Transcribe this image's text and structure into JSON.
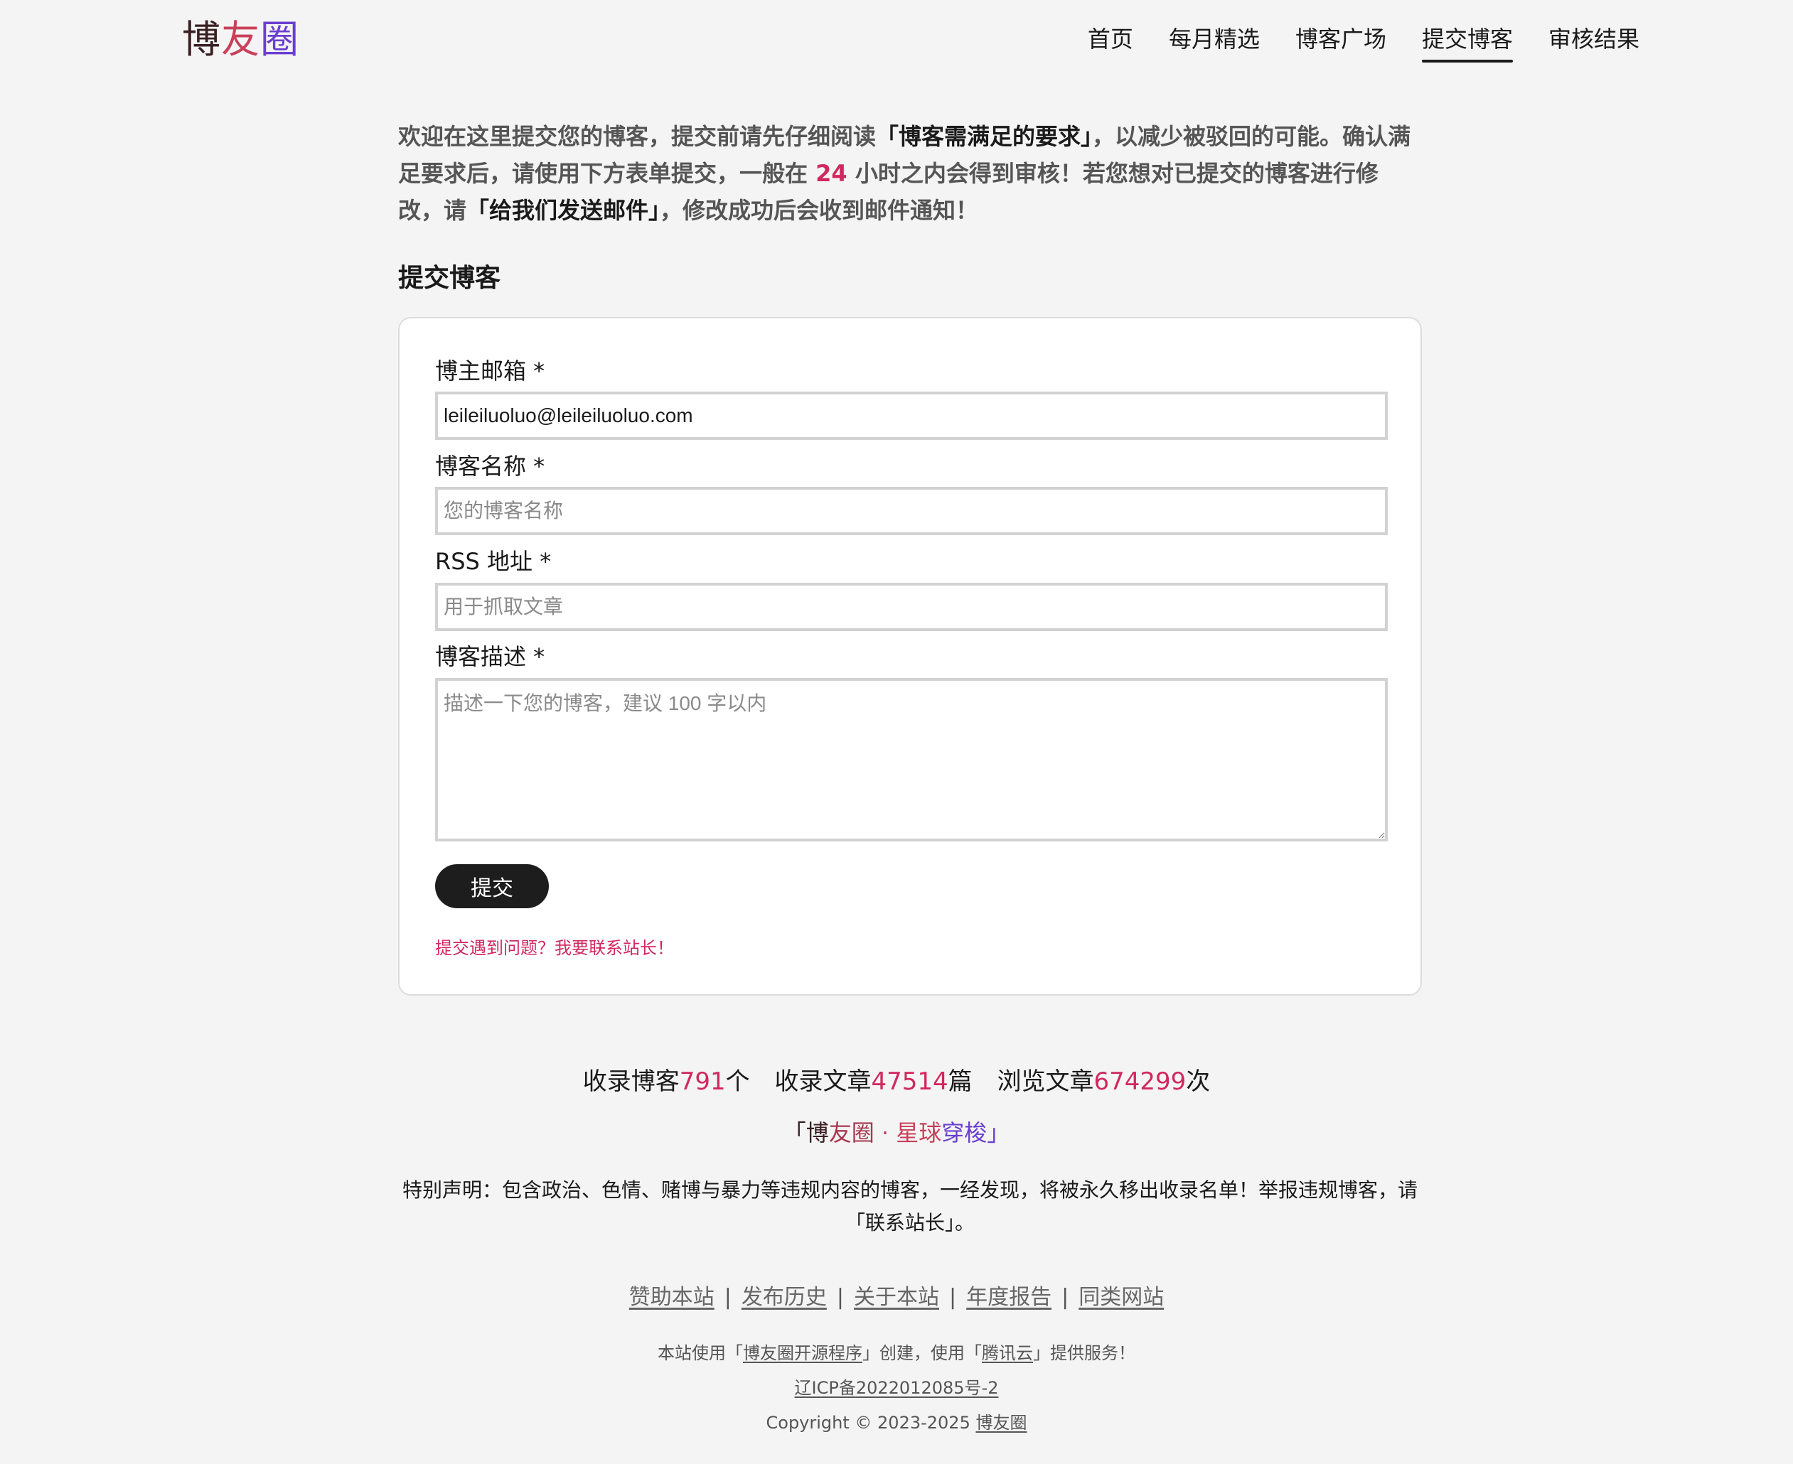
{
  "header": {
    "logo": [
      "博",
      "友",
      "圈"
    ],
    "nav": [
      {
        "label": "首页",
        "active": false
      },
      {
        "label": "每月精选",
        "active": false
      },
      {
        "label": "博客广场",
        "active": false
      },
      {
        "label": "提交博客",
        "active": true
      },
      {
        "label": "审核结果",
        "active": false
      }
    ]
  },
  "intro": {
    "part1": "欢迎在这里提交您的博客，提交前请先仔细阅读",
    "link1": "「博客需满足的要求」",
    "part2": "，以减少被驳回的可能。确认满足要求后，请使用下方表单提交，一般在 ",
    "hours": "24",
    "part3": " 小时之内会得到审核！若您想对已提交的博客进行修改，请",
    "link2": "「给我们发送邮件」",
    "part4": "，修改成功后会收到邮件通知！"
  },
  "form": {
    "title": "提交博客",
    "email_label": "博主邮箱 *",
    "email_value": "leileiluoluo@leileiluoluo.com",
    "name_label": "博客名称 *",
    "name_placeholder": "您的博客名称",
    "rss_label": "RSS 地址 *",
    "rss_placeholder": "用于抓取文章",
    "desc_label": "博客描述 *",
    "desc_placeholder": "描述一下您的博客，建议 100 字以内",
    "submit_label": "提交",
    "help_link": "提交遇到问题？我要联系站长！"
  },
  "stats": {
    "blogs_label": "收录博客",
    "blogs_count": "791",
    "blogs_unit": "个",
    "articles_label": "收录文章",
    "articles_count": "47514",
    "articles_unit": "篇",
    "views_label": "浏览文章",
    "views_count": "674299",
    "views_unit": "次"
  },
  "tagline": {
    "open": "「",
    "a": "博",
    "b": "友圈",
    "c": " · 星球",
    "d": "穿梭",
    "close": "」"
  },
  "disclaimer": "特别声明：包含政治、色情、赌博与暴力等违规内容的博客，一经发现，将被永久移出收录名单！举报违规博客，请「联系站长」。",
  "footer": {
    "links": [
      "赞助本站",
      "发布历史",
      "关于本站",
      "年度报告",
      "同类网站"
    ],
    "separator": "|",
    "built_prefix": "本站使用「",
    "built_link": "博友圈开源程序",
    "built_middle": "」创建，使用「",
    "host_link": "腾讯云",
    "built_suffix": "」提供服务！",
    "icp": "辽ICP备2022012085号-2",
    "copyright_prefix": "Copyright © 2023-2025 ",
    "copyright_link": "博友圈"
  }
}
